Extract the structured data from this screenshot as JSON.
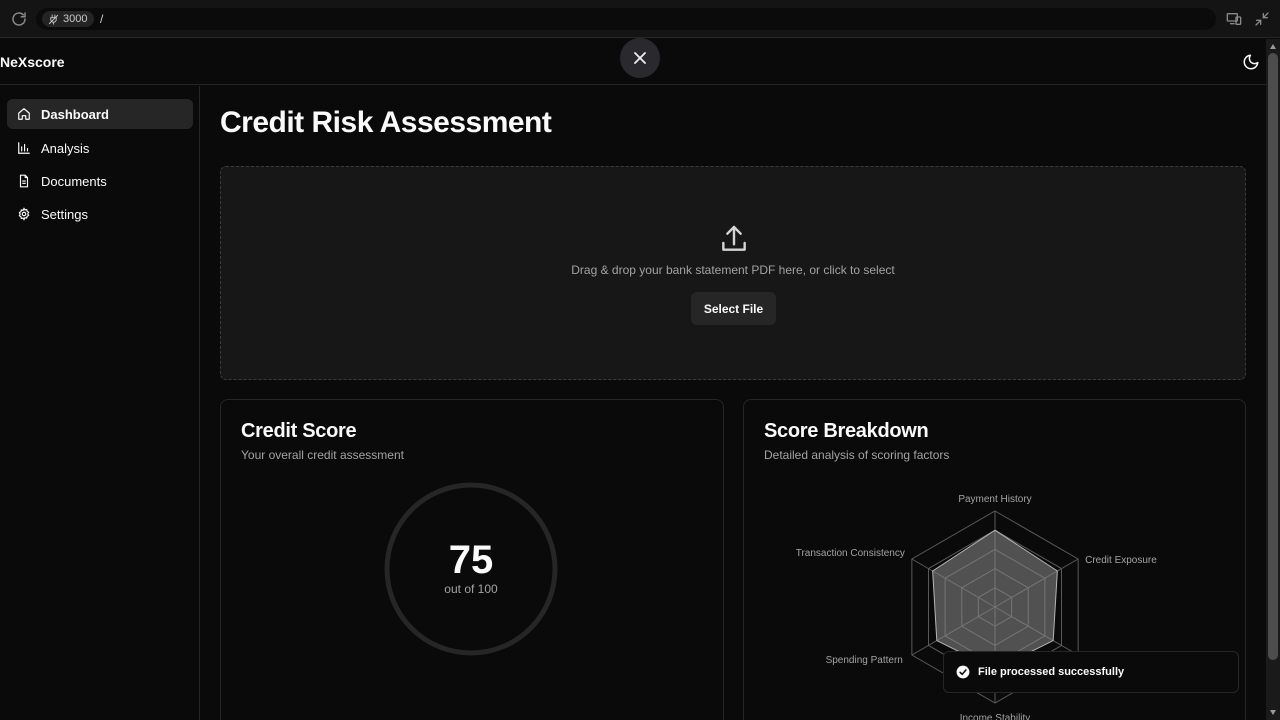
{
  "browser": {
    "port": "3000",
    "path": "/"
  },
  "header": {
    "brand": "NeXscore"
  },
  "sidebar": {
    "items": [
      {
        "label": "Dashboard",
        "icon": "home-icon",
        "active": true
      },
      {
        "label": "Analysis",
        "icon": "bar-chart-icon",
        "active": false
      },
      {
        "label": "Documents",
        "icon": "document-icon",
        "active": false
      },
      {
        "label": "Settings",
        "icon": "gear-icon",
        "active": false
      }
    ]
  },
  "main": {
    "title": "Credit Risk Assessment",
    "dropzone": {
      "text": "Drag & drop your bank statement PDF here, or click to select",
      "button": "Select File"
    },
    "credit_card": {
      "title": "Credit Score",
      "subtitle": "Your overall credit assessment",
      "score": "75",
      "caption": "out of 100"
    },
    "breakdown_card": {
      "title": "Score Breakdown",
      "subtitle": "Detailed analysis of scoring factors"
    }
  },
  "toast": {
    "message": "File processed successfully"
  },
  "colors": {
    "background": "#0a0a0a",
    "card": "#171717",
    "border": "#262626",
    "muted_text": "#a3a3a3"
  },
  "chart_data": {
    "type": "radar",
    "categories": [
      "Payment History",
      "Credit Exposure",
      "Income Stability",
      "Income Stability",
      "Spending Pattern",
      "Transaction Consistency"
    ],
    "axes": [
      "Payment History",
      "Credit Exposure",
      "",
      "Income Stability",
      "Spending Pattern",
      "Transaction Consistency"
    ],
    "values": [
      80,
      75,
      70,
      65,
      70,
      75
    ],
    "range": [
      0,
      100
    ],
    "grid_levels": 5
  }
}
